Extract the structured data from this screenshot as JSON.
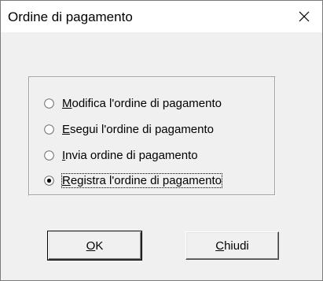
{
  "window": {
    "title": "Ordine di pagamento",
    "close_glyph": "✕"
  },
  "options": [
    {
      "pre": "",
      "accel": "M",
      "post": "odifica l'ordine di pagamento",
      "checked": false
    },
    {
      "pre": "",
      "accel": "E",
      "post": "segui l'ordine di pagamento",
      "checked": false
    },
    {
      "pre": "",
      "accel": "I",
      "post": "nvia ordine di pagamento",
      "checked": false
    },
    {
      "pre": "",
      "accel": "R",
      "post": "egistra l'ordine di pagamento",
      "checked": true
    }
  ],
  "buttons": {
    "ok": {
      "accel": "O",
      "post": "K"
    },
    "close": {
      "accel": "C",
      "post": "hiudi"
    }
  },
  "colors": {
    "dialog_bg": "#f0f0f0",
    "titlebar_bg": "#ffffff"
  }
}
